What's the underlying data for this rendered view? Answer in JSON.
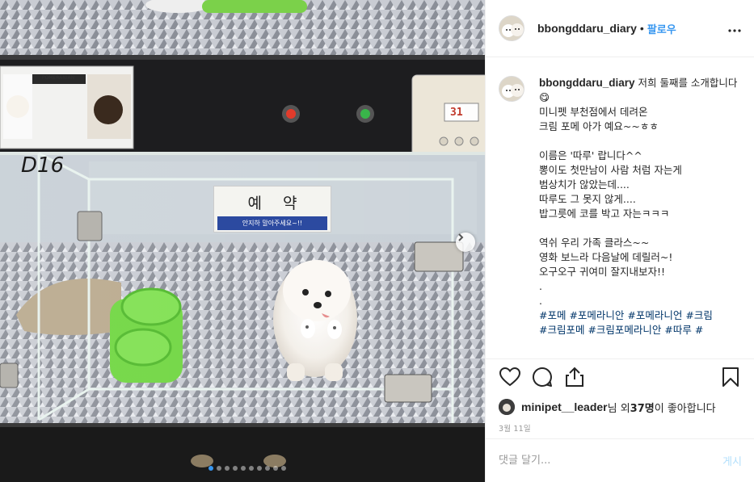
{
  "photo": {
    "store_sign": "예 약",
    "store_sign_sub": "안지하 말아주세요~!!",
    "cabinet_label": "D16",
    "card_breed": "POMERANIAN",
    "thermostat_reading": "31",
    "carousel_total": 10,
    "carousel_active": 0
  },
  "header": {
    "username": "bbongddaru_diary",
    "separator": "•",
    "follow_label": "팔로우"
  },
  "caption": {
    "username": "bbongddaru_diary",
    "text": " 저희 둘째를 소개합니다😋\n미니펫 부천점에서 데려온\n크림 포메 아가 예요~~ㅎㅎ\n\n이름은 '따루' 랍니다^^\n뽕이도 첫만남이 사람 처럼 자는게\n범상치가 않았는데....\n따루도 그 못지 않게....\n밥그릇에 코를 박고 자는ㅋㅋㅋ\n\n역쉬 우리 가족 클라스~~\n영화 보느라 다음날에 데릴러~!\n오구오구 귀여미 잘지내보자!!\n.\n.\n",
    "hashtags": "#포메 #포메라니안 #포메라니언 #크림\n#크림포메 #크림포메라니안 #따루 #"
  },
  "likes": {
    "liker": "minipet__leader",
    "suffix_1": "님 외 ",
    "count": "37명",
    "suffix_2": "이 좋아합니다"
  },
  "date": "3월 11일",
  "comment": {
    "placeholder": "댓글 달기...",
    "post_label": "게시"
  },
  "colors": {
    "accent": "#3897f0",
    "hashtag": "#003569",
    "post_disabled": "#b2dffc"
  }
}
